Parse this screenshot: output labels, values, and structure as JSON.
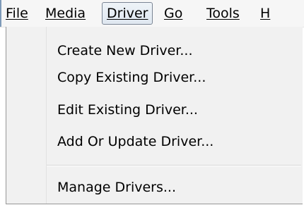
{
  "menubar": {
    "items": [
      {
        "label": "File"
      },
      {
        "label": "Media"
      },
      {
        "label": "Driver"
      },
      {
        "label": "Go"
      },
      {
        "label": "Tools"
      },
      {
        "label": "H"
      }
    ]
  },
  "dropdown": {
    "items": [
      {
        "label": "Create New Driver..."
      },
      {
        "label": "Copy Existing Driver..."
      },
      {
        "label": "Edit Existing Driver..."
      },
      {
        "label": "Add Or Update Driver..."
      },
      {
        "label": "Manage Drivers..."
      }
    ]
  }
}
